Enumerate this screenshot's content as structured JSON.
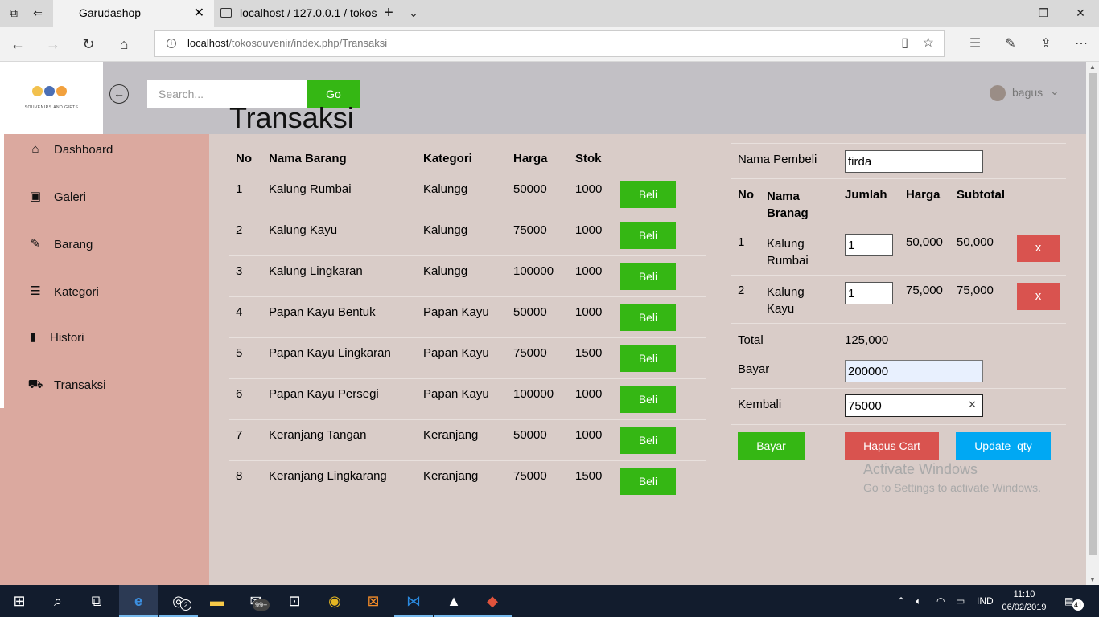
{
  "browser": {
    "tabs": [
      {
        "title": "Garudashop"
      },
      {
        "title": "localhost / 127.0.0.1 / tokos"
      }
    ],
    "url_host": "localhost",
    "url_path": "/tokosouvenir/index.php/Transaksi"
  },
  "header": {
    "search_placeholder": "Search...",
    "go_label": "Go",
    "username": "bagus",
    "logo_caption": "SOUVENIRS AND GIFTS"
  },
  "sidebar": {
    "items": [
      {
        "label": "Dashboard",
        "icon": "home-icon"
      },
      {
        "label": "Galeri",
        "icon": "image-icon"
      },
      {
        "label": "Barang",
        "icon": "pencil-icon"
      },
      {
        "label": "Kategori",
        "icon": "list-icon"
      },
      {
        "label": "Histori",
        "icon": "bookmark-icon"
      },
      {
        "label": "Transaksi",
        "icon": "cart-icon"
      }
    ]
  },
  "main": {
    "title": "Transaksi",
    "products": {
      "headers": [
        "No",
        "Nama Barang",
        "Kategori",
        "Harga",
        "Stok"
      ],
      "buy_label": "Beli",
      "rows": [
        {
          "no": "1",
          "nama": "Kalung Rumbai",
          "kategori": "Kalungg",
          "harga": "50000",
          "stok": "1000"
        },
        {
          "no": "2",
          "nama": "Kalung Kayu",
          "kategori": "Kalungg",
          "harga": "75000",
          "stok": "1000"
        },
        {
          "no": "3",
          "nama": "Kalung Lingkaran",
          "kategori": "Kalungg",
          "harga": "100000",
          "stok": "1000"
        },
        {
          "no": "4",
          "nama": "Papan Kayu Bentuk",
          "kategori": "Papan Kayu",
          "harga": "50000",
          "stok": "1000"
        },
        {
          "no": "5",
          "nama": "Papan Kayu Lingkaran",
          "kategori": "Papan Kayu",
          "harga": "75000",
          "stok": "1500"
        },
        {
          "no": "6",
          "nama": "Papan Kayu Persegi",
          "kategori": "Papan Kayu",
          "harga": "100000",
          "stok": "1000"
        },
        {
          "no": "7",
          "nama": "Keranjang Tangan",
          "kategori": "Keranjang",
          "harga": "50000",
          "stok": "1000"
        },
        {
          "no": "8",
          "nama": "Keranjang Lingkarang",
          "kategori": "Keranjang",
          "harga": "75000",
          "stok": "1500"
        }
      ]
    },
    "cart": {
      "buyer_label": "Nama Pembeli",
      "buyer_value": "firda",
      "headers": {
        "no": "No",
        "nama": "Nama\nBranag",
        "jumlah": "Jumlah",
        "harga": "Harga",
        "subtotal": "Subtotal"
      },
      "items": [
        {
          "no": "1",
          "nama": "Kalung\nRumbai",
          "jumlah": "1",
          "harga": "50,000",
          "subtotal": "50,000"
        },
        {
          "no": "2",
          "nama": "Kalung\nKayu",
          "jumlah": "1",
          "harga": "75,000",
          "subtotal": "75,000"
        }
      ],
      "remove_label": "x",
      "total_label": "Total",
      "total_value": "125,000",
      "bayar_label": "Bayar",
      "bayar_value": "200000",
      "kembali_label": "Kembali",
      "kembali_value": "75000",
      "btn_bayar": "Bayar",
      "btn_hapus": "Hapus Cart",
      "btn_update": "Update_qty"
    },
    "watermark": {
      "line1": "Activate Windows",
      "line2": "Go to Settings to activate Windows."
    }
  },
  "taskbar": {
    "badge_instagram": "2",
    "badge_mail": "99+",
    "lang": "IND",
    "time": "11:10",
    "date": "06/02/2019",
    "notifications": "41"
  },
  "colors": {
    "green": "#35b714",
    "red": "#d9534f",
    "blue": "#00a8f3",
    "sidebar": "#dba99f",
    "content": "#d9ccc8",
    "header": "#c2c0c5"
  }
}
